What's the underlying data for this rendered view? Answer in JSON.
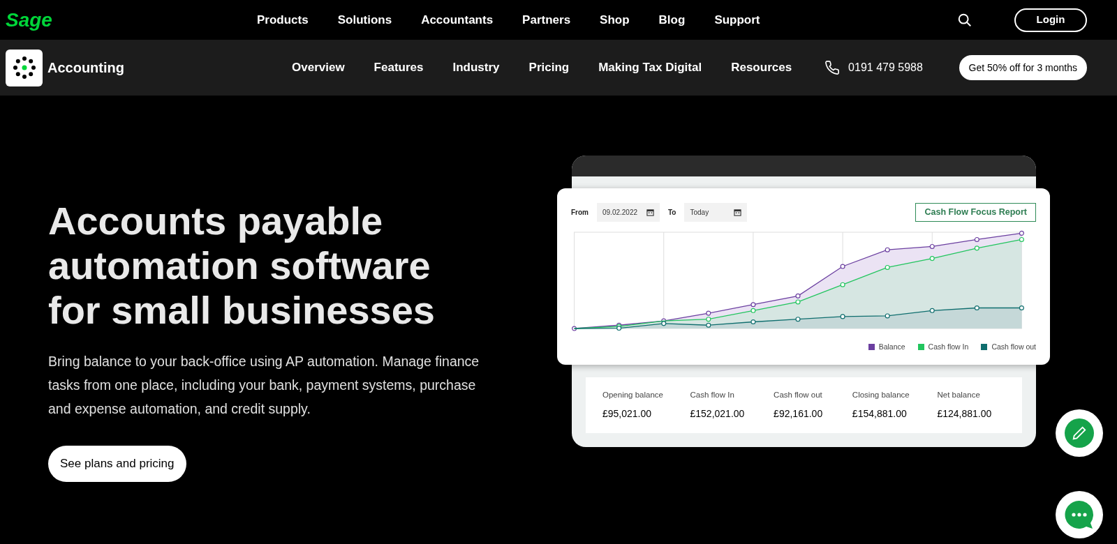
{
  "top_nav": {
    "logo": "Sage",
    "items": [
      "Products",
      "Solutions",
      "Accountants",
      "Partners",
      "Shop",
      "Blog",
      "Support"
    ],
    "login": "Login"
  },
  "sub_nav": {
    "product": "Accounting",
    "items": [
      "Overview",
      "Features",
      "Industry",
      "Pricing",
      "Making Tax Digital",
      "Resources"
    ],
    "phone": "0191 479 5988",
    "cta": "Get 50% off for 3 months"
  },
  "hero": {
    "heading": [
      "Accounts payable",
      "automation software",
      "for small businesses"
    ],
    "text": "Bring balance to your back-office using AP automation. Manage finance tasks from one place, including your bank, payment systems, purchase and expense automation, and credit supply.",
    "button": "See plans and pricing"
  },
  "report": {
    "from_label": "From",
    "from_value": "09.02.2022",
    "to_label": "To",
    "to_value": "Today",
    "button": "Cash Flow Focus Report",
    "legend": [
      {
        "label": "Balance",
        "color": "#6b3fa0"
      },
      {
        "label": "Cash flow In",
        "color": "#22c55e"
      },
      {
        "label": "Cash flow out",
        "color": "#0f6e6e"
      }
    ],
    "stats": [
      {
        "label": "Opening balance",
        "value": "£95,021.00"
      },
      {
        "label": "Cash flow In",
        "value": "£152,021.00"
      },
      {
        "label": "Cash flow out",
        "value": "£92,161.00"
      },
      {
        "label": "Closing balance",
        "value": "£154,881.00"
      },
      {
        "label": "Net balance",
        "value": "£124,881.00"
      }
    ]
  }
}
